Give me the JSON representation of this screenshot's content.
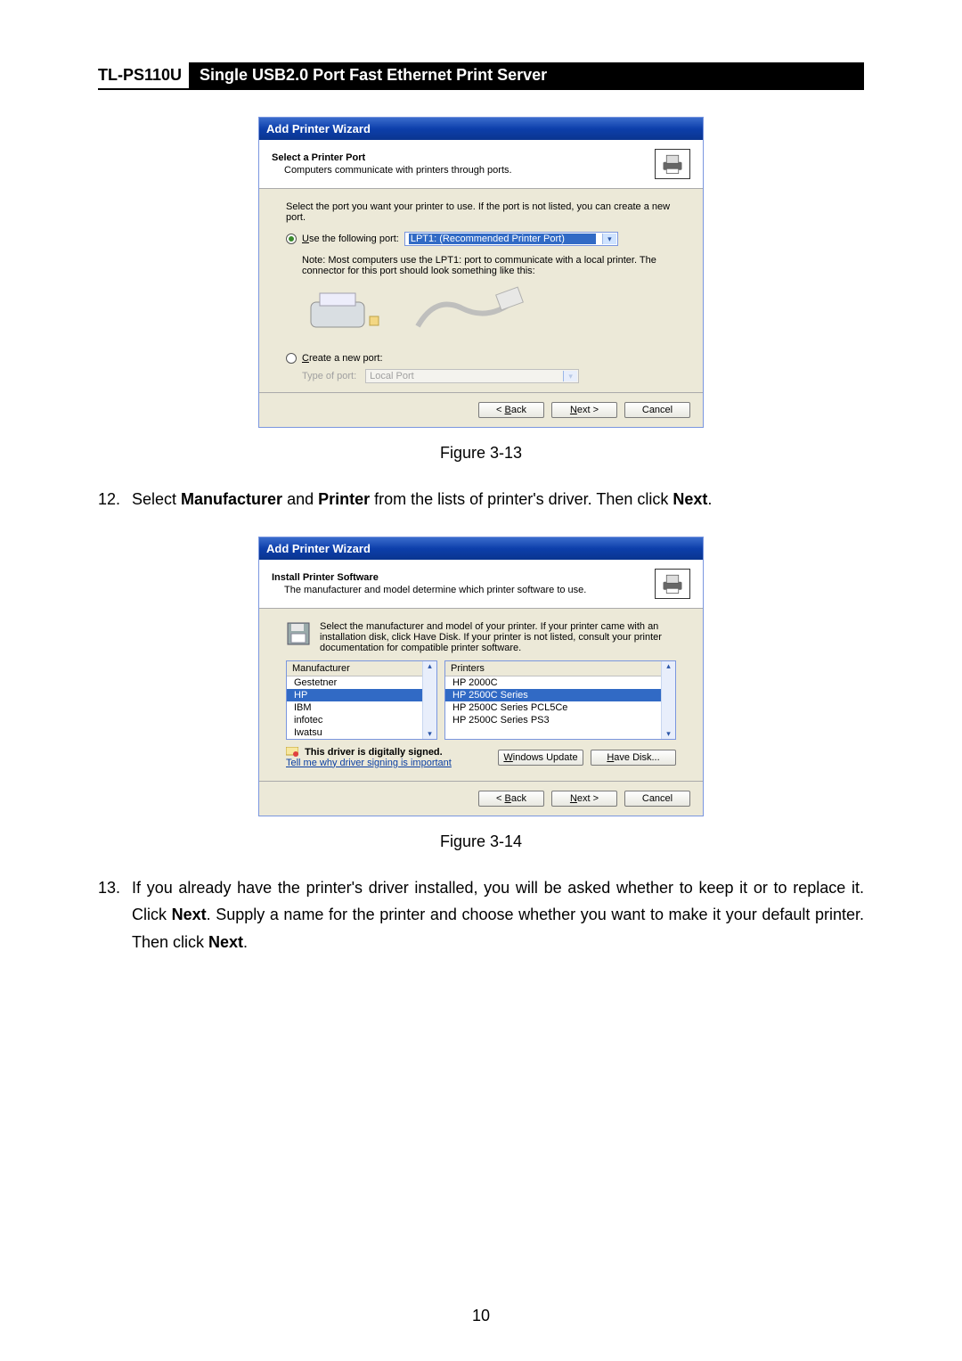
{
  "header": {
    "model": "TL-PS110U",
    "title": "Single USB2.0 Port Fast Ethernet Print Server"
  },
  "dialog1": {
    "title": "Add Printer Wizard",
    "header_title": "Select a Printer Port",
    "header_sub": "Computers communicate with printers through ports.",
    "intro": "Select the port you want your printer to use.  If the port is not listed, you can create a new port.",
    "use_port_label": "Use the following port:",
    "use_port_u": "U",
    "port_selected": "LPT1: (Recommended Printer Port)",
    "note": "Note: Most computers use the LPT1: port to communicate with a local printer. The connector for this port should look something like this:",
    "create_port_label": "Create a new port:",
    "create_port_u": "C",
    "type_of_port_label": "Type of port:",
    "type_of_port_value": "Local Port",
    "back": "< Back",
    "back_u": "B",
    "next": "Next >",
    "next_u": "N",
    "cancel": "Cancel"
  },
  "caption1": "Figure 3-13",
  "step12": {
    "num": "12.",
    "pre": "Select ",
    "b1": "Manufacturer",
    "mid1": " and ",
    "b2": "Printer",
    "mid2": " from the lists of printer's driver. Then click ",
    "b3": "Next",
    "post": "."
  },
  "dialog2": {
    "title": "Add Printer Wizard",
    "header_title": "Install Printer Software",
    "header_sub": "The manufacturer and model determine which printer software to use.",
    "info": "Select the manufacturer and model of your printer. If your printer came with an installation disk, click Have Disk. If your printer is not listed, consult your printer documentation for compatible printer software.",
    "manuf_header": "Manufacturer",
    "printers_header": "Printers",
    "manuf_items": [
      "Gestetner",
      "HP",
      "IBM",
      "infotec",
      "Iwatsu"
    ],
    "manuf_selected_index": 1,
    "printer_items": [
      "HP 2000C",
      "HP 2500C Series",
      "HP 2500C Series PCL5Ce",
      "HP 2500C Series PS3"
    ],
    "printer_selected_index": 1,
    "signed_text": "This driver is digitally signed.",
    "signed_link": "Tell me why driver signing is important",
    "windows_update": "Windows Update",
    "windows_update_u": "W",
    "have_disk": "Have Disk...",
    "have_disk_u": "H",
    "back": "< Back",
    "back_u": "B",
    "next": "Next >",
    "next_u": "N",
    "cancel": "Cancel"
  },
  "caption2": "Figure 3-14",
  "step13": {
    "num": "13.",
    "t1": "If you already have the printer's driver installed, you will be asked whether to keep it or to replace it. Click ",
    "b1": "Next",
    "t2": ". Supply a name for the printer and choose whether you want to make it your default printer. Then click ",
    "b2": "Next",
    "t3": "."
  },
  "page_number": "10"
}
